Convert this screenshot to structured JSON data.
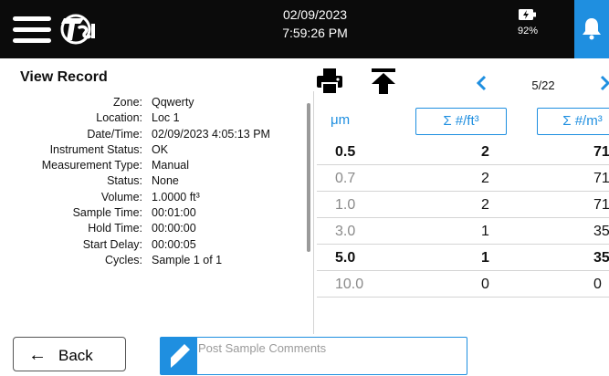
{
  "header": {
    "date": "02/09/2023",
    "time": "7:59:26 PM",
    "battery": "92%"
  },
  "record": {
    "title": "View Record",
    "fields": [
      {
        "label": "Zone:",
        "value": "Qqwerty"
      },
      {
        "label": "Location:",
        "value": "Loc 1"
      },
      {
        "label": "Date/Time:",
        "value": "02/09/2023 4:05:13 PM"
      },
      {
        "label": "Instrument Status:",
        "value": "OK"
      },
      {
        "label": "Measurement Type:",
        "value": "Manual"
      },
      {
        "label": "Status:",
        "value": "None"
      },
      {
        "label": "Volume:",
        "value": "1.0000 ft³"
      },
      {
        "label": "Sample Time:",
        "value": "00:01:00"
      },
      {
        "label": "Hold Time:",
        "value": "00:00:00"
      },
      {
        "label": "Start Delay:",
        "value": "00:00:05"
      },
      {
        "label": "Cycles:",
        "value": "Sample 1 of 1"
      }
    ]
  },
  "pager": {
    "indicator": "5/22"
  },
  "table": {
    "headers": [
      "μm",
      "Σ #/ft³",
      "Σ #/m³"
    ],
    "rows": [
      {
        "size": "0.5",
        "ft3": "2",
        "m3": "71",
        "style": "bold"
      },
      {
        "size": "0.7",
        "ft3": "2",
        "m3": "71",
        "style": "grey"
      },
      {
        "size": "1.0",
        "ft3": "2",
        "m3": "71",
        "style": "grey"
      },
      {
        "size": "3.0",
        "ft3": "1",
        "m3": "35",
        "style": "grey"
      },
      {
        "size": "5.0",
        "ft3": "1",
        "m3": "35",
        "style": "bold"
      },
      {
        "size": "10.0",
        "ft3": "0",
        "m3": "0",
        "style": "grey"
      }
    ]
  },
  "footer": {
    "back_label": "Back",
    "comments_placeholder": "Post Sample Comments"
  },
  "icons": {
    "menu": "hamburger-menu-icon",
    "logo": "tsi-logo",
    "battery": "battery-charging-icon",
    "bell": "bell-icon",
    "print": "printer-icon",
    "top": "arrow-to-top-icon",
    "prev": "chevron-left-icon",
    "next": "chevron-right-icon",
    "back": "arrow-left-icon",
    "pencil": "pencil-icon"
  },
  "colors": {
    "accent": "#1f8fe0",
    "header_bg": "#0b0b0b",
    "muted_text": "#8a8a8a"
  }
}
